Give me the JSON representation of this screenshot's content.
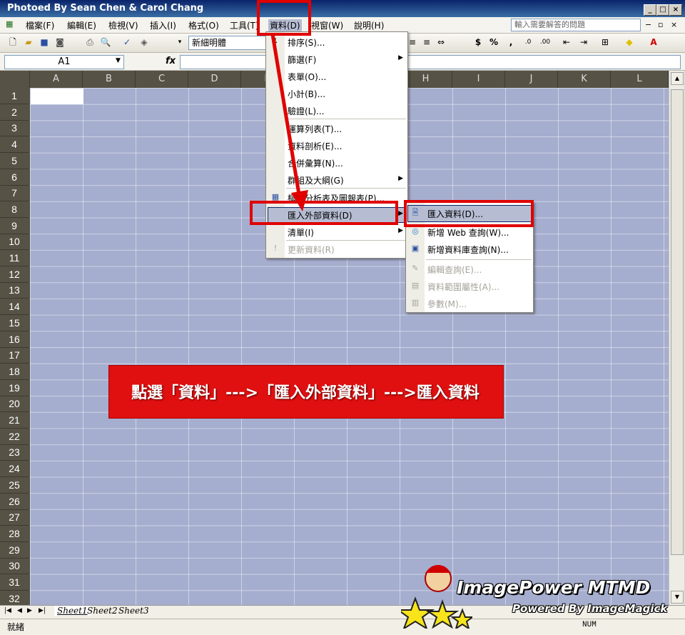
{
  "window": {
    "title": "Photoed By Sean Chen & Carol Chang"
  },
  "menubar": {
    "items": [
      "檔案(F)",
      "編輯(E)",
      "檢視(V)",
      "插入(I)",
      "格式(O)",
      "工具(T)",
      "資料(D)",
      "視窗(W)",
      "說明(H)"
    ],
    "help_placeholder": "輸入需要解答的問題"
  },
  "toolbar": {
    "font_name": "新細明體"
  },
  "formula_bar": {
    "cell_ref": "A1",
    "fx": "fx"
  },
  "grid": {
    "columns": [
      "A",
      "B",
      "C",
      "D",
      "E",
      "F",
      "G",
      "H",
      "I",
      "J",
      "K",
      "L"
    ],
    "rows": [
      "1",
      "2",
      "3",
      "4",
      "5",
      "6",
      "7",
      "8",
      "9",
      "10",
      "11",
      "12",
      "13",
      "14",
      "15",
      "16",
      "17",
      "18",
      "19",
      "20",
      "21",
      "22",
      "23",
      "24",
      "25",
      "26",
      "27",
      "28",
      "29",
      "30",
      "31",
      "32"
    ]
  },
  "data_menu": {
    "items": [
      {
        "label": "排序(S)...",
        "arrow": false
      },
      {
        "label": "篩選(F)",
        "arrow": true
      },
      {
        "label": "表單(O)...",
        "arrow": false
      },
      {
        "label": "小計(B)...",
        "arrow": false
      },
      {
        "label": "驗證(L)...",
        "arrow": false
      },
      {
        "label": "運算列表(T)...",
        "arrow": false
      },
      {
        "label": "資料剖析(E)...",
        "arrow": false
      },
      {
        "label": "合併彙算(N)...",
        "arrow": false
      },
      {
        "label": "群組及大綱(G)",
        "arrow": true
      },
      {
        "label": "樞紐分析表及圖報表(P)...",
        "arrow": false
      },
      {
        "label": "匯入外部資料(D)",
        "arrow": true
      },
      {
        "label": "清單(I)",
        "arrow": true
      },
      {
        "label": "更新資料(R)",
        "arrow": false
      }
    ]
  },
  "submenu": {
    "items": [
      {
        "label": "匯入資料(D)...",
        "disabled": false
      },
      {
        "label": "新增 Web 查詢(W)...",
        "disabled": false
      },
      {
        "label": "新增資料庫查詢(N)...",
        "disabled": false
      },
      {
        "label": "編輯查詢(E)...",
        "disabled": true
      },
      {
        "label": "資料範圍屬性(A)...",
        "disabled": true
      },
      {
        "label": "參數(M)...",
        "disabled": true
      }
    ]
  },
  "annotation": {
    "text": "點選「資料」--->「匯入外部資料」--->匯入資料"
  },
  "sheets": [
    "Sheet1",
    "Sheet2",
    "Sheet3"
  ],
  "status": {
    "left": "就緒",
    "num": "NUM"
  },
  "logo": {
    "title": "ImagePower MTMD",
    "subtitle": "Powered By ImageMagick"
  },
  "colors": {
    "accent_red": "#e00000",
    "grid_blue": "#a6aecf",
    "header_dark": "#565245"
  }
}
